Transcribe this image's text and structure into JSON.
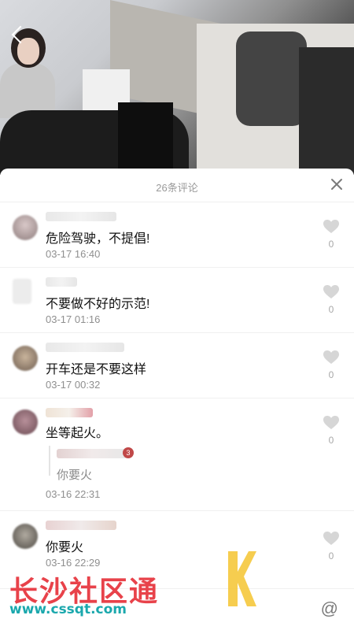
{
  "sheet": {
    "title": "26条评论",
    "close_icon": "close-icon"
  },
  "comments": [
    {
      "text": "危险驾驶，不提倡!",
      "time": "03-17 16:40",
      "likes": "0"
    },
    {
      "text": "不要做不好的示范!",
      "time": "03-17 01:16",
      "likes": "0"
    },
    {
      "text": "开车还是不要这样",
      "time": "03-17 00:32",
      "likes": "0"
    },
    {
      "text": "坐等起火。",
      "time": "03-16 22:31",
      "likes": "0",
      "reply": {
        "badge": "3",
        "text": "你要火"
      }
    },
    {
      "text": "你要火",
      "time": "03-16 22:29",
      "likes": "0"
    }
  ],
  "input": {
    "at_symbol": "@"
  },
  "watermark": {
    "title": "长沙社区通",
    "url": "www.cssqt.com"
  },
  "colors": {
    "accent_red": "#e8424a",
    "accent_teal": "#1ba8ad",
    "timestamp": "#8f8f8f"
  }
}
